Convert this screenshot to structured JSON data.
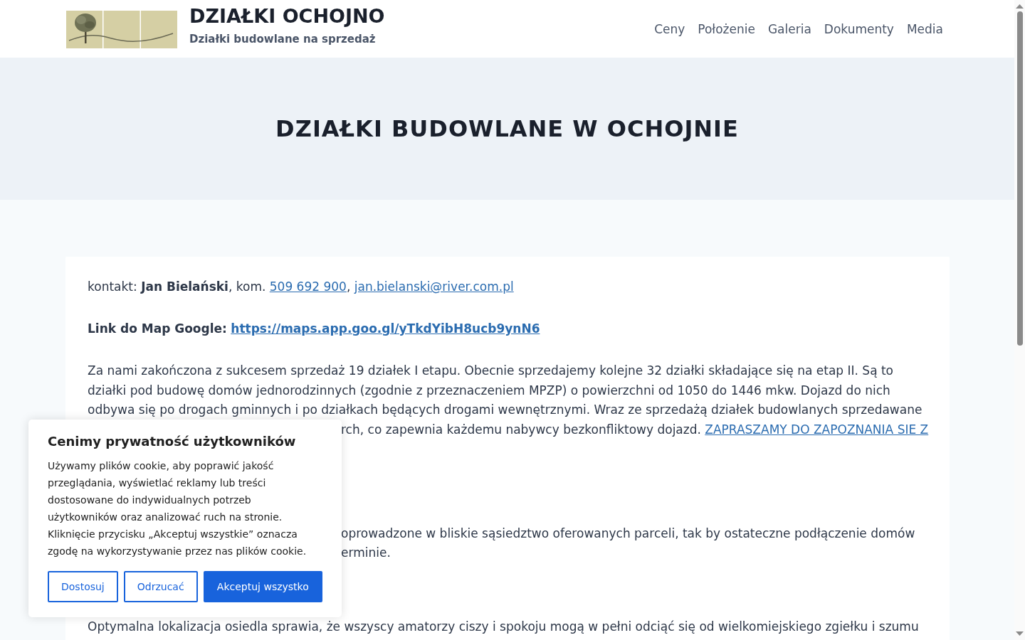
{
  "header": {
    "site_title": "DZIAŁKI OCHOJNO",
    "tagline": "Działki budowlane na sprzedaż",
    "nav": [
      {
        "label": "Ceny"
      },
      {
        "label": "Położenie"
      },
      {
        "label": "Galeria"
      },
      {
        "label": "Dokumenty"
      },
      {
        "label": "Media"
      }
    ]
  },
  "hero": {
    "title": "DZIAŁKI BUDOWLANE W OCHOJNIE"
  },
  "content": {
    "contact": [
      {
        "kind": "text",
        "text": "kontakt: **Jan Bielański**, kom. "
      },
      {
        "kind": "link",
        "text": "509 692 900"
      },
      {
        "kind": "text",
        "text": ", "
      },
      {
        "kind": "link",
        "text": "jan.bielanski@river.com.pl"
      }
    ],
    "map_link": {
      "label": "Link do Map Google:",
      "url": "https://maps.app.goo.gl/yTkdYibH8ucb9ynN6"
    },
    "paragraphs": [
      {
        "lines": [
          {
            "kind": "full",
            "text": "Za nami zakończona z sukcesem sprzedaż 19 działek I etapu. Obecnie sprzedajemy kolejne 32 działki składające się na etap II. Są to"
          },
          {
            "kind": "full",
            "text": "działki pod budowę domów jednorodzinnych (zgodnie z przeznaczeniem MPZP) o powierzchni od 1050 do 1446 mkw. Dojazd do nich"
          },
          {
            "kind": "full",
            "text": "odbywa się po drogach gminnych i po działkach będących drogami wewnętrznymi. Wraz ze sprzedażą działek budowlanych sprzedawane"
          },
          {
            "kind": "after-cookie",
            "text": "rch, co zapewnia każdemu nabywcy bezkonfliktowy dojazd. ",
            "link": "ZAPRASZAMY DO ZAPOZNANIA SIE Z"
          }
        ]
      },
      {
        "lines": [
          {
            "kind": "after-cookie",
            "text": "oprowadzone w bliskie sąsiedztwo oferowanych parceli, tak by ostateczne podłączenie domów"
          },
          {
            "kind": "after-cookie",
            "text": "erminie."
          }
        ]
      },
      {
        "lines": [
          {
            "kind": "full",
            "text": "Optymalna lokalizacja osiedla sprawia, że wszyscy amatorzy ciszy i spokoju mogą w pełni odciąć się od wielkomiejskiego zgiełku i szumu"
          }
        ]
      }
    ]
  },
  "cookie_banner": {
    "title": "Cenimy prywatność użytkowników",
    "text": "Używamy plików cookie, aby poprawić jakość przeglądania, wyświetlać reklamy lub treści dostosowane do indywidualnych potrzeb użytkowników oraz analizować ruch na stronie. Kliknięcie przycisku „Akceptuj wszystkie” oznacza zgodę na wykorzystywanie przez nas plików cookie.",
    "buttons": [
      {
        "label": "Dostosuj",
        "kind": "outline"
      },
      {
        "label": "Odrzucać",
        "kind": "outline"
      },
      {
        "label": "Akceptuj wszystko",
        "kind": "primary"
      }
    ]
  }
}
